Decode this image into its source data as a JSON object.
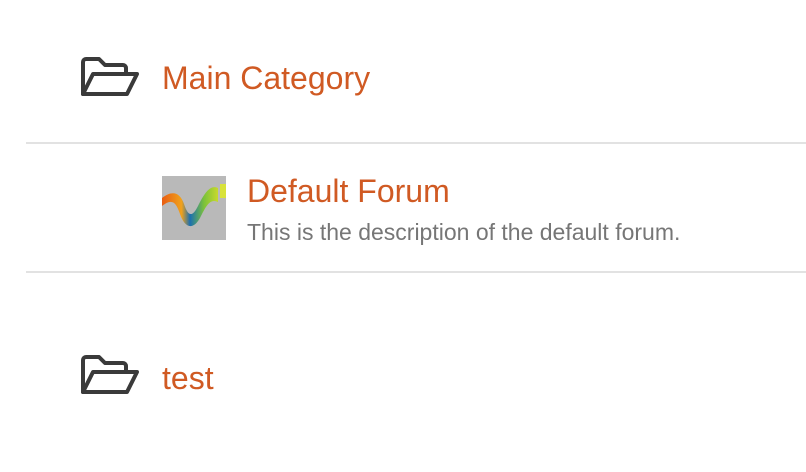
{
  "colors": {
    "link": "#d05a23",
    "description": "#767676",
    "icon": "#3a3a3a",
    "divider": "#e2e2e2"
  },
  "categories": [
    {
      "icon": "folder-open-icon",
      "title": "Main Category",
      "forums": [
        {
          "icon": "forum-avatar-wave",
          "title": "Default Forum",
          "description": "This is the description of the default forum."
        }
      ]
    },
    {
      "icon": "folder-open-icon",
      "title": "test",
      "forums": []
    }
  ]
}
